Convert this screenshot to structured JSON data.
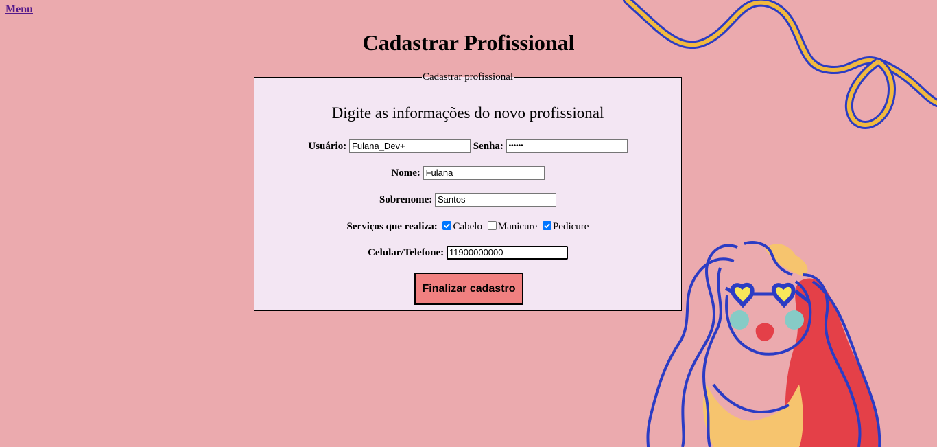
{
  "nav": {
    "menu_label": "Menu"
  },
  "page": {
    "title": "Cadastrar Profissional"
  },
  "form": {
    "legend": "Cadastrar profissional",
    "subtitle": "Digite as informações do novo profissional",
    "usuario": {
      "label": "Usuário:",
      "value": "Fulana_Dev+"
    },
    "senha": {
      "label": "Senha:",
      "value": "••••••"
    },
    "nome": {
      "label": "Nome:",
      "value": "Fulana"
    },
    "sobrenome": {
      "label": "Sobrenome:",
      "value": "Santos"
    },
    "servicos": {
      "label": "Serviços que realiza:",
      "options": [
        {
          "label": "Cabelo",
          "checked": true
        },
        {
          "label": "Manicure",
          "checked": false
        },
        {
          "label": "Pedicure",
          "checked": true
        }
      ]
    },
    "telefone": {
      "label": "Celular/Telefone:",
      "value": "11900000000"
    },
    "submit_label": "Finalizar cadastro"
  },
  "colors": {
    "background": "#ebaaae",
    "form_background": "#f3e6f3",
    "button": "#f08080",
    "link": "#551a8b",
    "checkbox": "#0075ff"
  },
  "decoration": {
    "top_right": "wavy-ribbon-illustration",
    "bottom_right": "woman-with-heart-sunglasses-illustration"
  }
}
